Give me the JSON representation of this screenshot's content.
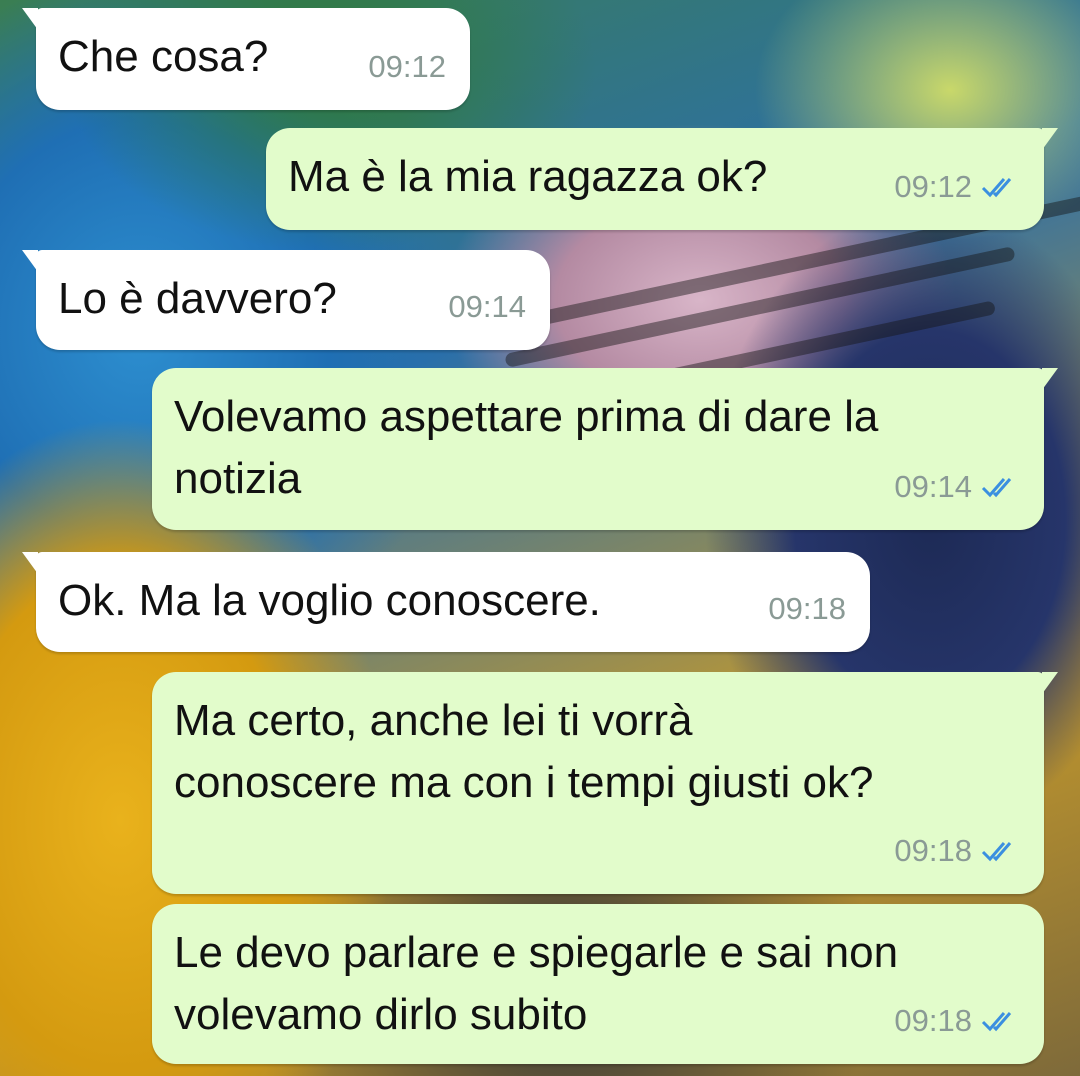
{
  "colors": {
    "incoming_bubble": "#ffffff",
    "outgoing_bubble": "#e2fccb",
    "timestamp": "#8a9a95",
    "read_ticks": "#3b8fe0"
  },
  "messages": [
    {
      "direction": "incoming",
      "text": "Che cosa?",
      "time": "09:12"
    },
    {
      "direction": "outgoing",
      "text": "Ma è la mia ragazza ok?",
      "time": "09:12",
      "status_icon": "double-check-read-icon"
    },
    {
      "direction": "incoming",
      "text": "Lo è davvero?",
      "time": "09:14"
    },
    {
      "direction": "outgoing",
      "text": "Volevamo aspettare prima di dare la\nnotizia",
      "time": "09:14",
      "status_icon": "double-check-read-icon"
    },
    {
      "direction": "incoming",
      "text": "Ok. Ma la voglio conoscere.",
      "time": "09:18"
    },
    {
      "direction": "outgoing",
      "text": "Ma certo, anche lei ti vorrà\nconoscere ma con i tempi giusti ok?",
      "time": "09:18",
      "status_icon": "double-check-read-icon"
    },
    {
      "direction": "outgoing",
      "text": "Le devo parlare e spiegarle e sai non\nvolevamo dirlo subito",
      "time": "09:18",
      "status_icon": "double-check-read-icon"
    }
  ]
}
